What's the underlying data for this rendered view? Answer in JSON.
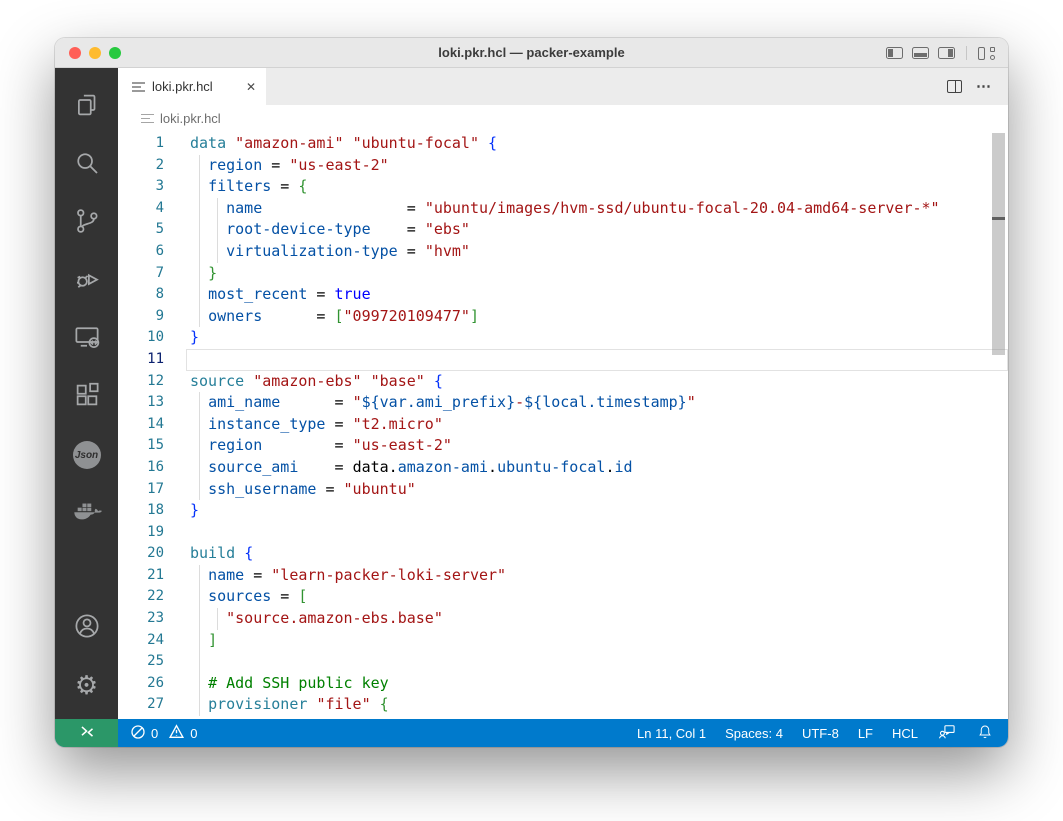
{
  "colors": {
    "titlebar_bg": "#e8e8e8",
    "tabbar_bg": "#ececec",
    "activitybar_bg": "#333333",
    "statusbar_bg": "#007acc",
    "remote_bg": "#2b9768",
    "type": "#267f99",
    "prop": "#0451a5",
    "string": "#a31515",
    "keyword": "#0000ff",
    "bracket1": "#0431fa",
    "bracket2": "#319331",
    "comment": "#008000",
    "plain": "#000000",
    "lineno": "#237893",
    "lineno_active": "#0b216f"
  },
  "window": {
    "title": "loki.pkr.hcl — packer-example",
    "traffic_lights": [
      "close",
      "minimize",
      "zoom"
    ],
    "layout_controls": [
      "toggle-primary-sidebar",
      "toggle-panel",
      "toggle-secondary-sidebar",
      "customize-layout"
    ]
  },
  "activity_bar": {
    "items": [
      "explorer",
      "search",
      "source-control",
      "run-and-debug",
      "remote-explorer",
      "extensions",
      "json-extension",
      "docker"
    ],
    "json_badge": "Json",
    "bottom_items": [
      "accounts",
      "settings"
    ],
    "settings_glyph": "⚙"
  },
  "tab_bar": {
    "active_tab": "loki.pkr.hcl",
    "close_glyph": "✕",
    "more_glyph": "⋯",
    "actions": [
      "split-editor",
      "more-actions"
    ]
  },
  "breadcrumb": {
    "label": "loki.pkr.hcl"
  },
  "editor": {
    "language": "hcl",
    "lines": [
      {
        "n": "1",
        "g": 0,
        "s": [
          [
            "data",
            "t"
          ],
          [
            " ",
            "p"
          ],
          [
            "\"amazon-ami\"",
            "s"
          ],
          [
            " ",
            "p"
          ],
          [
            "\"ubuntu-focal\"",
            "s"
          ],
          [
            " ",
            "p"
          ],
          [
            "{",
            "b1"
          ]
        ]
      },
      {
        "n": "2",
        "g": 1,
        "s": [
          [
            "  ",
            "p"
          ],
          [
            "region",
            "r"
          ],
          [
            " = ",
            "p"
          ],
          [
            "\"us-east-2\"",
            "s"
          ]
        ]
      },
      {
        "n": "3",
        "g": 1,
        "s": [
          [
            "  ",
            "p"
          ],
          [
            "filters",
            "r"
          ],
          [
            " = ",
            "p"
          ],
          [
            "{",
            "b2"
          ]
        ]
      },
      {
        "n": "4",
        "g": 2,
        "s": [
          [
            "    ",
            "p"
          ],
          [
            "name",
            "r"
          ],
          [
            "                = ",
            "p"
          ],
          [
            "\"ubuntu/images/hvm-ssd/ubuntu-focal-20.04-amd64-server-*\"",
            "s"
          ]
        ]
      },
      {
        "n": "5",
        "g": 2,
        "s": [
          [
            "    ",
            "p"
          ],
          [
            "root-device-type",
            "r"
          ],
          [
            "    = ",
            "p"
          ],
          [
            "\"ebs\"",
            "s"
          ]
        ]
      },
      {
        "n": "6",
        "g": 2,
        "s": [
          [
            "    ",
            "p"
          ],
          [
            "virtualization-type",
            "r"
          ],
          [
            " = ",
            "p"
          ],
          [
            "\"hvm\"",
            "s"
          ]
        ]
      },
      {
        "n": "7",
        "g": 1,
        "s": [
          [
            "  ",
            "p"
          ],
          [
            "}",
            "b2"
          ]
        ]
      },
      {
        "n": "8",
        "g": 1,
        "s": [
          [
            "  ",
            "p"
          ],
          [
            "most_recent",
            "r"
          ],
          [
            " = ",
            "p"
          ],
          [
            "true",
            "k"
          ]
        ]
      },
      {
        "n": "9",
        "g": 1,
        "s": [
          [
            "  ",
            "p"
          ],
          [
            "owners",
            "r"
          ],
          [
            "      = ",
            "p"
          ],
          [
            "[",
            "b2"
          ],
          [
            "\"099720109477\"",
            "s"
          ],
          [
            "]",
            "b2"
          ]
        ]
      },
      {
        "n": "10",
        "g": 0,
        "s": [
          [
            "}",
            "b1"
          ]
        ]
      },
      {
        "n": "11",
        "g": 0,
        "active": true,
        "s": []
      },
      {
        "n": "12",
        "g": 0,
        "s": [
          [
            "source",
            "t"
          ],
          [
            " ",
            "p"
          ],
          [
            "\"amazon-ebs\"",
            "s"
          ],
          [
            " ",
            "p"
          ],
          [
            "\"base\"",
            "s"
          ],
          [
            " ",
            "p"
          ],
          [
            "{",
            "b1"
          ]
        ]
      },
      {
        "n": "13",
        "g": 1,
        "s": [
          [
            "  ",
            "p"
          ],
          [
            "ami_name",
            "r"
          ],
          [
            "      = ",
            "p"
          ],
          [
            "\"",
            "s"
          ],
          [
            "${var.ami_prefix}",
            "r"
          ],
          [
            "-",
            "s"
          ],
          [
            "${local.timestamp}",
            "r"
          ],
          [
            "\"",
            "s"
          ]
        ]
      },
      {
        "n": "14",
        "g": 1,
        "s": [
          [
            "  ",
            "p"
          ],
          [
            "instance_type",
            "r"
          ],
          [
            " = ",
            "p"
          ],
          [
            "\"t2.micro\"",
            "s"
          ]
        ]
      },
      {
        "n": "15",
        "g": 1,
        "s": [
          [
            "  ",
            "p"
          ],
          [
            "region",
            "r"
          ],
          [
            "        = ",
            "p"
          ],
          [
            "\"us-east-2\"",
            "s"
          ]
        ]
      },
      {
        "n": "16",
        "g": 1,
        "s": [
          [
            "  ",
            "p"
          ],
          [
            "source_ami",
            "r"
          ],
          [
            "    = ",
            "p"
          ],
          [
            "data.",
            "p"
          ],
          [
            "amazon-ami",
            "r"
          ],
          [
            ".",
            "p"
          ],
          [
            "ubuntu-focal",
            "r"
          ],
          [
            ".",
            "p"
          ],
          [
            "id",
            "r"
          ]
        ]
      },
      {
        "n": "17",
        "g": 1,
        "s": [
          [
            "  ",
            "p"
          ],
          [
            "ssh_username",
            "r"
          ],
          [
            " = ",
            "p"
          ],
          [
            "\"ubuntu\"",
            "s"
          ]
        ]
      },
      {
        "n": "18",
        "g": 0,
        "s": [
          [
            "}",
            "b1"
          ]
        ]
      },
      {
        "n": "19",
        "g": 0,
        "s": []
      },
      {
        "n": "20",
        "g": 0,
        "s": [
          [
            "build",
            "t"
          ],
          [
            " ",
            "p"
          ],
          [
            "{",
            "b1"
          ]
        ]
      },
      {
        "n": "21",
        "g": 1,
        "s": [
          [
            "  ",
            "p"
          ],
          [
            "name",
            "r"
          ],
          [
            " = ",
            "p"
          ],
          [
            "\"learn-packer-loki-server\"",
            "s"
          ]
        ]
      },
      {
        "n": "22",
        "g": 1,
        "s": [
          [
            "  ",
            "p"
          ],
          [
            "sources",
            "r"
          ],
          [
            " = ",
            "p"
          ],
          [
            "[",
            "b2"
          ]
        ]
      },
      {
        "n": "23",
        "g": 2,
        "s": [
          [
            "    ",
            "p"
          ],
          [
            "\"source.amazon-ebs.base\"",
            "s"
          ]
        ]
      },
      {
        "n": "24",
        "g": 1,
        "s": [
          [
            "  ",
            "p"
          ],
          [
            "]",
            "b2"
          ]
        ]
      },
      {
        "n": "25",
        "g": 1,
        "s": []
      },
      {
        "n": "26",
        "g": 1,
        "s": [
          [
            "  ",
            "p"
          ],
          [
            "# Add SSH public key",
            "c"
          ]
        ]
      },
      {
        "n": "27",
        "g": 1,
        "s": [
          [
            "  ",
            "p"
          ],
          [
            "provisioner",
            "t"
          ],
          [
            " ",
            "p"
          ],
          [
            "\"file\"",
            "s"
          ],
          [
            " ",
            "p"
          ],
          [
            "{",
            "b2"
          ]
        ]
      }
    ]
  },
  "status_bar": {
    "remote_indicator": "open-remote-window",
    "errors": "0",
    "warnings": "0",
    "line_col": "Ln 11, Col 1",
    "indent": "Spaces: 4",
    "encoding": "UTF-8",
    "eol": "LF",
    "language": "HCL",
    "right_icons": [
      "feedback",
      "notifications"
    ]
  }
}
